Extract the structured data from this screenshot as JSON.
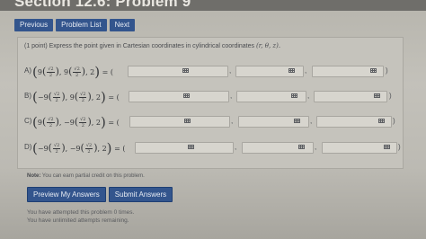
{
  "header": {
    "title": "Section 12.6: Problem 9"
  },
  "nav": {
    "previous": "Previous",
    "problem_list": "Problem List",
    "next": "Next"
  },
  "problem": {
    "prompt": "(1 point) Express the point given in Cartesian coordinates in cylindrical coordinates",
    "coords": "(r, θ, z)."
  },
  "parts": [
    {
      "label": "A)",
      "x_sign": "",
      "x_coef": "9",
      "y_sign": "",
      "y_coef": "9",
      "z": "2"
    },
    {
      "label": "B)",
      "x_sign": "−",
      "x_coef": "9",
      "y_sign": "",
      "y_coef": "9",
      "z": "2"
    },
    {
      "label": "C)",
      "x_sign": "",
      "x_coef": "9",
      "y_sign": "−",
      "y_coef": "9",
      "z": "2"
    },
    {
      "label": "D)",
      "x_sign": "−",
      "x_coef": "9",
      "y_sign": "−",
      "y_coef": "9",
      "z": "2"
    }
  ],
  "math": {
    "frac_num": "√2",
    "frac_den": "2",
    "equals_open": "= (",
    "comma": ",",
    "close": ")"
  },
  "note": {
    "label": "Note:",
    "text": "You can earn partial credit on this problem."
  },
  "actions": {
    "preview": "Preview My Answers",
    "submit": "Submit Answers"
  },
  "status": {
    "attempts": "You have attempted this problem 0 times.",
    "unlimited": "You have unlimited attempts remaining."
  }
}
